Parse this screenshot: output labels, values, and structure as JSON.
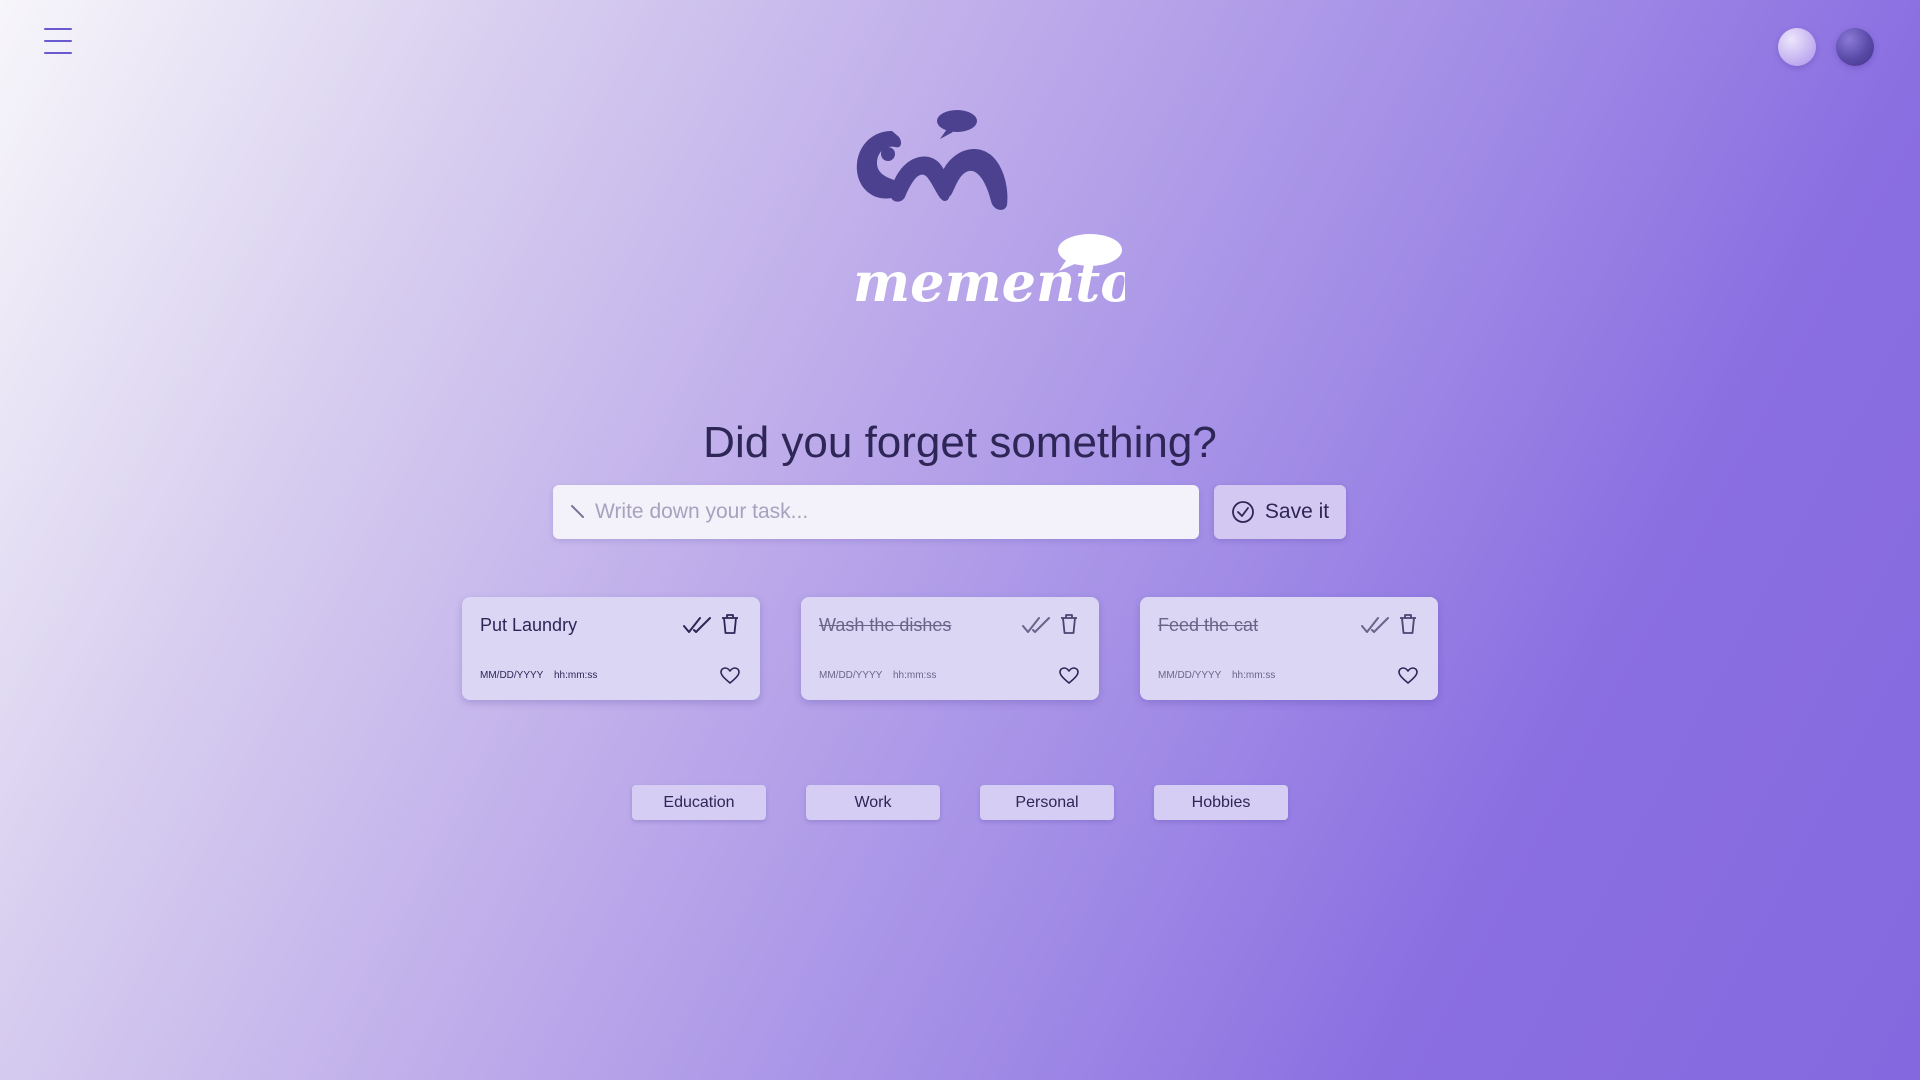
{
  "header": {
    "menu_icon": "hamburger-menu-icon",
    "theme_light_color": "#c8b8f2",
    "theme_dark_color": "#5a4aa8"
  },
  "logo": {
    "text": "memento",
    "mark_color": "#4b418f",
    "script_color": "#ffffff"
  },
  "main": {
    "headline": "Did you forget something?",
    "input_placeholder": "Write down your task...",
    "input_icon": "pencil-icon",
    "save_label": "Save it",
    "save_icon": "check-circle-icon"
  },
  "tasks": [
    {
      "title": "Put Laundry",
      "date": "MM/DD/YYYY",
      "time": "hh:mm:ss",
      "completed": false
    },
    {
      "title": "Wash the dishes",
      "date": "MM/DD/YYYY",
      "time": "hh:mm:ss",
      "completed": true
    },
    {
      "title": "Feed the cat",
      "date": "MM/DD/YYYY",
      "time": "hh:mm:ss",
      "completed": true
    }
  ],
  "categories": [
    "Education",
    "Work",
    "Personal",
    "Hobbies"
  ],
  "colors": {
    "accent": "#6a5ad0",
    "text": "#2e2656",
    "card": "#dcd6f5"
  }
}
